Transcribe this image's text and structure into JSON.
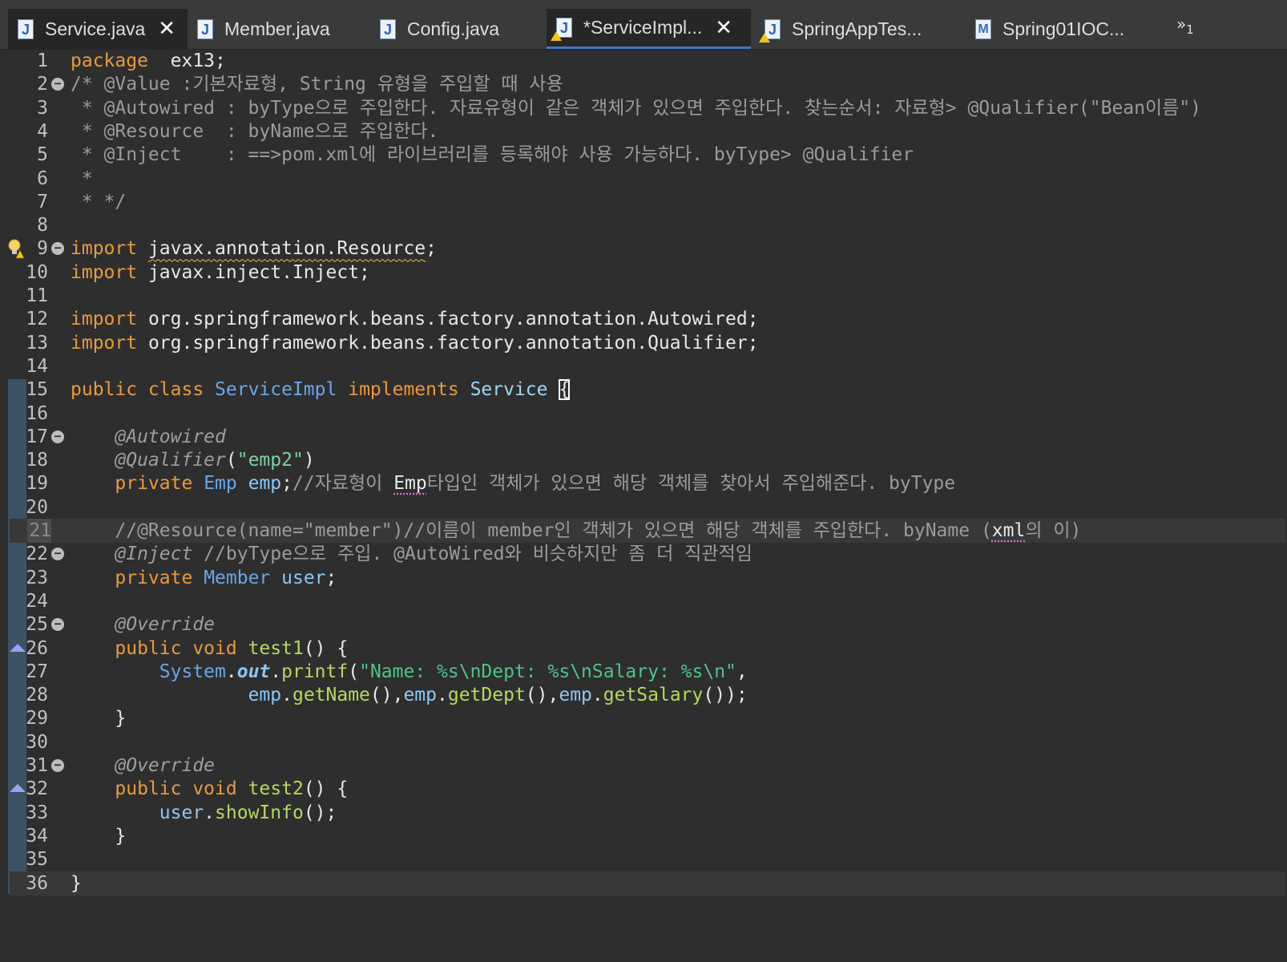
{
  "tabs": [
    {
      "label": "Service.java",
      "icon": "java-file-icon",
      "closable": true
    },
    {
      "label": "Member.java",
      "icon": "java-file-icon",
      "closable": false
    },
    {
      "label": "Config.java",
      "icon": "java-file-icon",
      "closable": false
    },
    {
      "label": "*ServiceImpl...",
      "icon": "java-file-warning-icon",
      "closable": true
    },
    {
      "label": "SpringAppTes...",
      "icon": "java-file-warning-icon",
      "closable": false
    },
    {
      "label": "Spring01IOC...",
      "icon": "maven-pom-icon",
      "closable": false
    }
  ],
  "overflow": {
    "glyph": "»",
    "count": "1"
  },
  "editor": {
    "current_line": 21,
    "lines": [
      {
        "n": "1",
        "parts": [
          [
            "kw",
            "package"
          ],
          [
            "",
            "  ex13;"
          ]
        ]
      },
      {
        "n": "2",
        "fold": true,
        "parts": [
          [
            "cm",
            "/* @Value :기본자료형, String 유형을 주입할 때 사용"
          ]
        ]
      },
      {
        "n": "3",
        "parts": [
          [
            "cm",
            " * @Autowired : byType으로 주입한다. 자료유형이 같은 객체가 있으면 주입한다. 찾는순서: 자료형> @Qualifier(\"Bean이름\")"
          ]
        ]
      },
      {
        "n": "4",
        "parts": [
          [
            "cm",
            " * @Resource  : byName으로 주입한다."
          ]
        ]
      },
      {
        "n": "5",
        "parts": [
          [
            "cm",
            " * @Inject    : ==>pom.xml에 라이브러리를 등록해야 사용 가능하다. byType> @Qualifier"
          ]
        ]
      },
      {
        "n": "6",
        "parts": [
          [
            "cm",
            " *"
          ]
        ]
      },
      {
        "n": "7",
        "parts": [
          [
            "cm",
            " * */"
          ]
        ]
      },
      {
        "n": "8",
        "parts": []
      },
      {
        "n": "9",
        "fold": true,
        "bulb": true,
        "parts": [
          [
            "kw",
            "import"
          ],
          [
            "",
            " "
          ],
          [
            "wavy",
            "javax.annotation.Resource"
          ],
          [
            "",
            ";"
          ]
        ]
      },
      {
        "n": "10",
        "parts": [
          [
            "kw",
            "import"
          ],
          [
            "",
            " javax.inject.Inject;"
          ]
        ]
      },
      {
        "n": "11",
        "parts": []
      },
      {
        "n": "12",
        "parts": [
          [
            "kw",
            "import"
          ],
          [
            "",
            " org.springframework.beans.factory.annotation.Autowired;"
          ]
        ]
      },
      {
        "n": "13",
        "parts": [
          [
            "kw",
            "import"
          ],
          [
            "",
            " org.springframework.beans.factory.annotation.Qualifier;"
          ]
        ]
      },
      {
        "n": "14",
        "parts": []
      },
      {
        "n": "15",
        "parts": [
          [
            "kw",
            "public class"
          ],
          [
            "",
            " "
          ],
          [
            "ty",
            "ServiceImpl"
          ],
          [
            "",
            " "
          ],
          [
            "kw",
            "implements"
          ],
          [
            "",
            " "
          ],
          [
            "ty2",
            "Service"
          ],
          [
            "",
            " "
          ],
          [
            "caretbox",
            "{"
          ]
        ]
      },
      {
        "n": "16",
        "parts": []
      },
      {
        "n": "17",
        "fold": true,
        "parts": [
          [
            "an",
            "    @Autowired"
          ]
        ]
      },
      {
        "n": "18",
        "parts": [
          [
            "an",
            "    @Qualifier"
          ],
          [
            "",
            "("
          ],
          [
            "st",
            "\"emp2\""
          ],
          [
            "",
            ")"
          ]
        ]
      },
      {
        "n": "19",
        "parts": [
          [
            "kw",
            "    private"
          ],
          [
            "",
            " "
          ],
          [
            "ty",
            "Emp"
          ],
          [
            "",
            " "
          ],
          [
            "fd",
            "emp"
          ],
          [
            "",
            ";"
          ],
          [
            "cm",
            "//자료형이 "
          ],
          [
            "wavyp",
            "Emp"
          ],
          [
            "cm",
            "타입인 객체가 있으면 해당 객체를 찾아서 주입해준다. byType"
          ]
        ]
      },
      {
        "n": "20",
        "parts": []
      },
      {
        "n": "21",
        "parts": [
          [
            "cm",
            "    //@Resource(name=\"member\")//이름이 member인 객체가 있으면 해당 객체를 주입한다. byName ("
          ],
          [
            "wavyp",
            "xml"
          ],
          [
            "cm",
            "의 이)"
          ]
        ]
      },
      {
        "n": "22",
        "fold": true,
        "parts": [
          [
            "an",
            "    @Inject"
          ],
          [
            "cm",
            " //byType으로 주입. @AutoWired와 비슷하지만 좀 더 직관적임"
          ]
        ]
      },
      {
        "n": "23",
        "parts": [
          [
            "kw",
            "    private"
          ],
          [
            "",
            " "
          ],
          [
            "ty",
            "Member"
          ],
          [
            "",
            " "
          ],
          [
            "fd",
            "user"
          ],
          [
            "",
            ";"
          ]
        ]
      },
      {
        "n": "24",
        "parts": []
      },
      {
        "n": "25",
        "fold": true,
        "parts": [
          [
            "an",
            "    @Override"
          ]
        ]
      },
      {
        "n": "26",
        "override": true,
        "parts": [
          [
            "kw",
            "    public void"
          ],
          [
            "",
            " "
          ],
          [
            "mt",
            "test1"
          ],
          [
            "",
            "() {"
          ]
        ]
      },
      {
        "n": "27",
        "parts": [
          [
            "ty",
            "        System"
          ],
          [
            "",
            "."
          ],
          [
            "sf",
            "out"
          ],
          [
            "",
            "."
          ],
          [
            "mt",
            "printf"
          ],
          [
            "",
            "("
          ],
          [
            "st2",
            "\"Name: %s\\nDept: %s\\nSalary: %s\\n\""
          ],
          [
            "",
            ","
          ]
        ]
      },
      {
        "n": "28",
        "parts": [
          [
            "fd",
            "                emp"
          ],
          [
            "",
            "."
          ],
          [
            "mt",
            "getName"
          ],
          [
            "",
            "(),"
          ],
          [
            "fd",
            "emp"
          ],
          [
            "",
            "."
          ],
          [
            "mt",
            "getDept"
          ],
          [
            "",
            "(),"
          ],
          [
            "fd",
            "emp"
          ],
          [
            "",
            "."
          ],
          [
            "mt",
            "getSalary"
          ],
          [
            "",
            "());"
          ]
        ]
      },
      {
        "n": "29",
        "parts": [
          [
            "",
            "    }"
          ]
        ]
      },
      {
        "n": "30",
        "parts": []
      },
      {
        "n": "31",
        "fold": true,
        "parts": [
          [
            "an",
            "    @Override"
          ]
        ]
      },
      {
        "n": "32",
        "override": true,
        "parts": [
          [
            "kw",
            "    public void"
          ],
          [
            "",
            " "
          ],
          [
            "mt",
            "test2"
          ],
          [
            "",
            "() {"
          ]
        ]
      },
      {
        "n": "33",
        "parts": [
          [
            "fd",
            "        user"
          ],
          [
            "",
            "."
          ],
          [
            "mt",
            "showInfo"
          ],
          [
            "",
            "();"
          ]
        ]
      },
      {
        "n": "34",
        "parts": [
          [
            "",
            "    }"
          ]
        ]
      },
      {
        "n": "35",
        "parts": []
      },
      {
        "n": "36",
        "parts": [
          [
            "",
            "}"
          ]
        ]
      }
    ]
  }
}
